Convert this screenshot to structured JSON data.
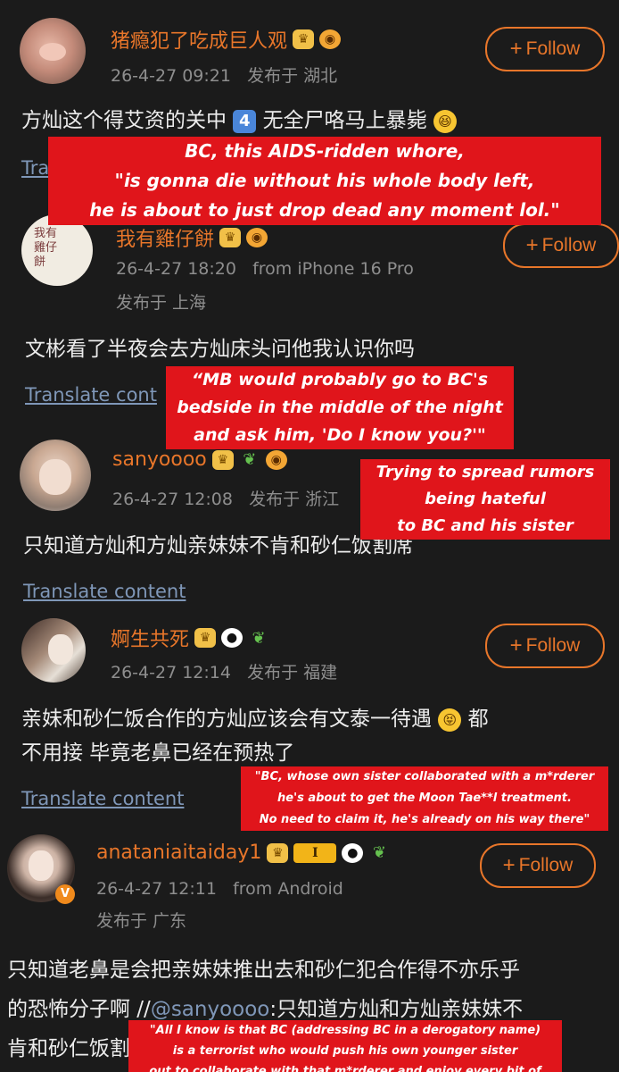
{
  "comments": [
    {
      "username": "猪瘾犯了吃成巨人观",
      "timestamp": "26-4-27 09:21",
      "source": "",
      "location": "发布于 湖北",
      "follow_label": "Follow",
      "content": "方灿这个得艾资的关中",
      "content_tail": "无全尸咯马上暴毙",
      "keycap": "4",
      "translate_label": "Translate cont"
    },
    {
      "username": "我有雞仔餅",
      "timestamp": "26-4-27 18:20",
      "source": "from iPhone 16 Pro",
      "location": "发布于 上海",
      "follow_label": "Follow",
      "content": "文彬看了半夜会去方灿床头问他我认识你吗",
      "translate_label": "Translate cont"
    },
    {
      "username": "sanyoooo",
      "timestamp": "26-4-27 12:08",
      "source": "",
      "location": "发布于 浙江",
      "content": "只知道方灿和方灿亲妹妹不肯和砂仁饭割席",
      "translate_label": "Translate content"
    },
    {
      "username": "婀生共死",
      "timestamp": "26-4-27 12:14",
      "source": "",
      "location": "发布于 福建",
      "follow_label": "Follow",
      "content_line1": "亲妹和砂仁饭合作的方灿应该会有文泰一待遇",
      "content_line1_tail": "都",
      "content_line2": "不用接 毕竟老鼻已经在预热了",
      "translate_label": "Translate content"
    },
    {
      "username": "anataniaitaiday1",
      "level_badge": "I",
      "timestamp": "26-4-27 12:11",
      "source": "from Android",
      "location": "发布于 广东",
      "follow_label": "Follow",
      "content_line1": "只知道老鼻是会把亲妹妹推出去和砂仁犯合作得不亦乐乎",
      "content_line2_pre": "的恐怖分子啊 //",
      "content_line2_mention": "@sanyoooo",
      "content_line2_post": ":只知道方灿和方灿亲妹妹不",
      "content_line3": "肯和砂仁饭割席"
    }
  ],
  "annotations": {
    "a1": [
      "BC, this AIDS-ridden whore,",
      "\"is gonna die without his whole body left,",
      "he is about to just drop dead any moment lol.\""
    ],
    "a2": [
      "“MB would probably go to BC's",
      "bedside in the middle of the night",
      "and ask him, 'Do I know you?'\""
    ],
    "a3": [
      "Trying to spread rumors",
      "being hateful",
      "to BC and his sister"
    ],
    "a4": [
      "\"BC, whose own sister collaborated with a  m*rderer",
      "he's about to get the Moon Tae**l treatment.",
      "No need to claim it, he's already on his way there\""
    ],
    "a5": [
      "\"All I know is that BC (addressing BC in a derogatory name)",
      "is a terrorist who would push his own younger sister",
      "out to collaborate with that  m*rderer and enjoy every bit of it.\""
    ]
  },
  "colors": {
    "accent": "#e8762a",
    "background": "#1b1b1b",
    "link": "#7f97b8",
    "annotation_bg": "#e0151b"
  }
}
